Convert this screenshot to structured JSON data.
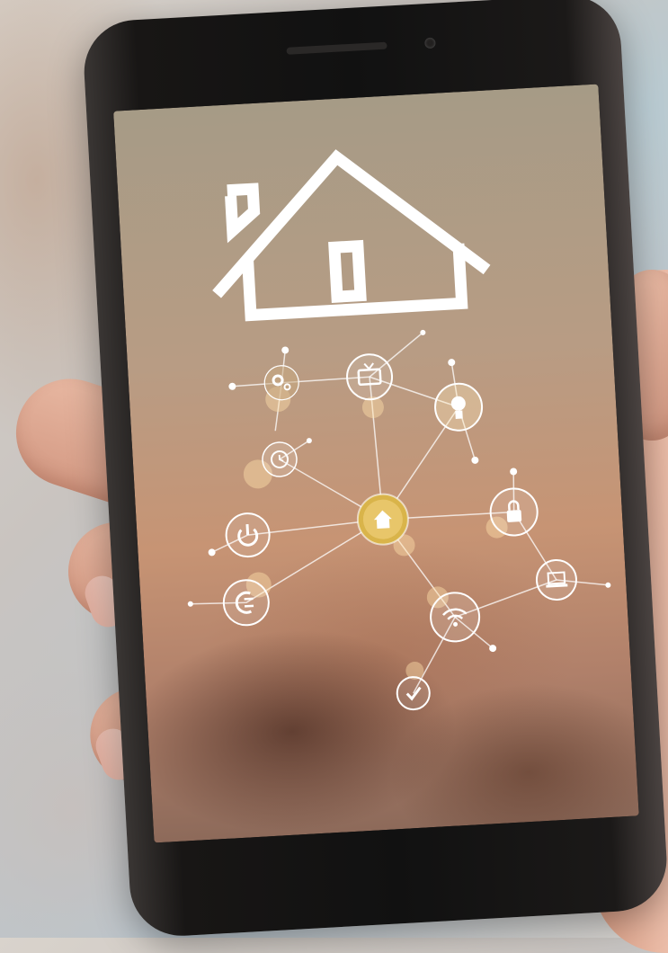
{
  "scene": {
    "description_icons": [
      "house-outline-icon",
      "gear-settings-icon",
      "television-icon",
      "light-bulb-icon",
      "clock-icon",
      "home-hub-icon",
      "power-icon",
      "lock-icon",
      "plug-icon",
      "laptop-icon",
      "wifi-icon",
      "check-icon"
    ],
    "colors": {
      "hub_gold": "#d9b44a",
      "icon_ring": "#ffffff",
      "phone_body": "#151413",
      "skin": "#e2ae98"
    }
  }
}
